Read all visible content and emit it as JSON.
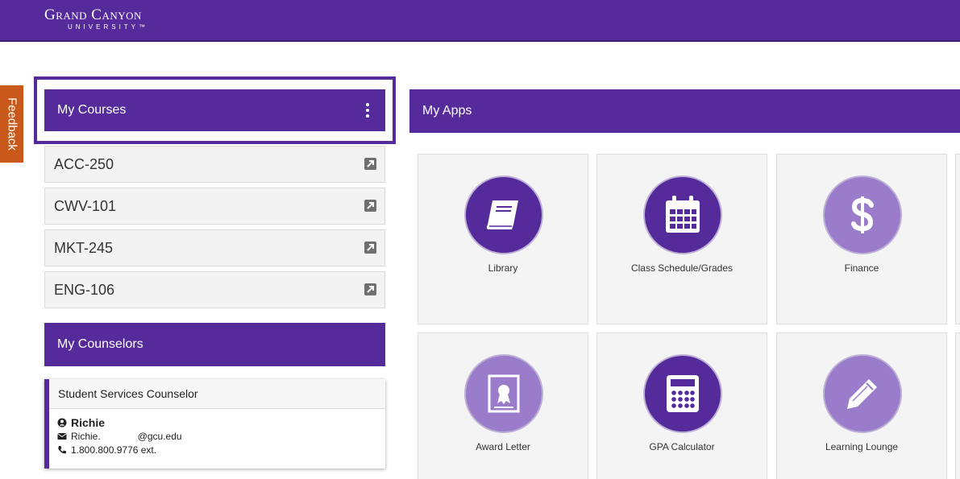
{
  "header": {
    "logo_line1": "Grand Canyon",
    "logo_line2": "UNIVERSITY™"
  },
  "feedback": {
    "label": "Feedback"
  },
  "courses": {
    "title": "My Courses",
    "items": [
      {
        "code": "ACC-250"
      },
      {
        "code": "CWV-101"
      },
      {
        "code": "MKT-245"
      },
      {
        "code": "ENG-106"
      }
    ]
  },
  "counselors": {
    "title": "My Counselors",
    "card": {
      "role": "Student Services Counselor",
      "name": "Richie",
      "email_prefix": "Richie.",
      "email_domain": "@gcu.edu",
      "phone": "1.800.800.9776 ext."
    }
  },
  "apps": {
    "title": "My Apps",
    "tiles": [
      {
        "label": "Library",
        "icon": "book-icon",
        "style": "dark"
      },
      {
        "label": "Class Schedule/Grades",
        "icon": "calendar-icon",
        "style": "dark"
      },
      {
        "label": "Finance",
        "icon": "dollar-icon",
        "style": "light"
      },
      {
        "label": "Award Letter",
        "icon": "award-certificate-icon",
        "style": "light"
      },
      {
        "label": "GPA Calculator",
        "icon": "calculator-icon",
        "style": "dark"
      },
      {
        "label": "Learning Lounge",
        "icon": "pencil-icon",
        "style": "light"
      }
    ]
  },
  "colors": {
    "brand_purple": "#552a9a",
    "light_purple": "#9a7ccb",
    "feedback_orange": "#c8591a"
  }
}
